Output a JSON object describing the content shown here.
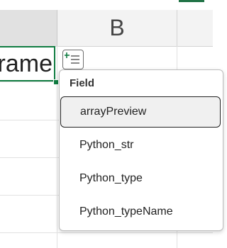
{
  "sheet": {
    "columns": [
      "B"
    ],
    "active_cell_text": "rame",
    "card_icon": "card-icon"
  },
  "dropdown": {
    "header": "Field",
    "items": [
      "arrayPreview",
      "Python_str",
      "Python_type",
      "Python_typeName"
    ],
    "selected_index": 0
  },
  "colors": {
    "accent": "#107c41",
    "header_bg": "#e1e1e1"
  }
}
